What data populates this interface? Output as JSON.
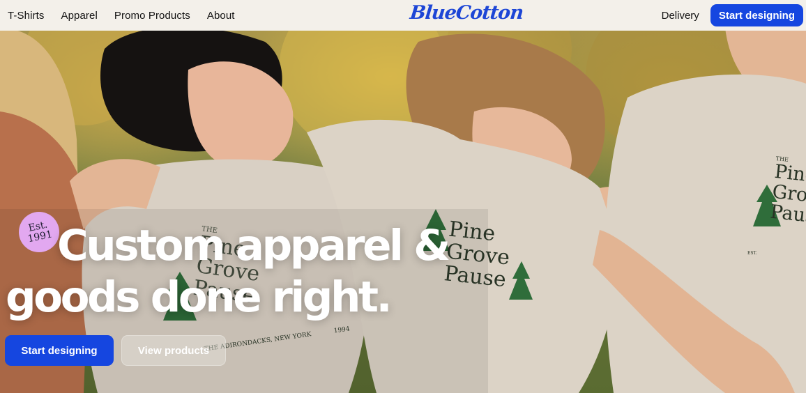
{
  "nav": {
    "links": [
      "T-Shirts",
      "Apparel",
      "Promo Products",
      "About"
    ],
    "logo": "BlueCotton",
    "delivery": "Delivery",
    "cta": "Start designing"
  },
  "hero": {
    "badge_line1": "Est.",
    "badge_line2": "1991",
    "headline_line1": "Custom apparel &",
    "headline_line2": "goods done right.",
    "primary_cta": "Start designing",
    "secondary_cta": "View products",
    "shirt_print": {
      "the": "THE",
      "line1": "Pine",
      "line2": "Grove",
      "line3": "Pause",
      "est": "EST.",
      "year": "1994",
      "footer": "THE ADIRONDACKS, NEW YORK"
    }
  },
  "colors": {
    "brand_blue": "#1546e0",
    "nav_bg": "#f3f0ea",
    "badge_purple": "#e2a8f0"
  }
}
